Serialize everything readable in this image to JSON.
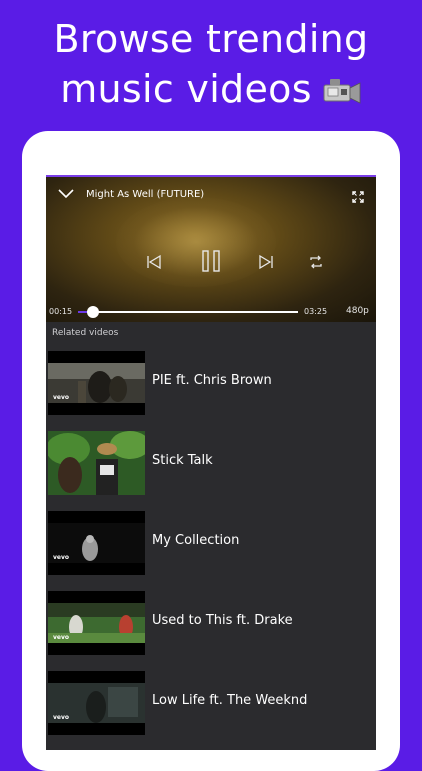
{
  "headline": {
    "line1": "Browse trending",
    "line2": "music videos",
    "emoji": "video-camera-icon"
  },
  "player": {
    "title": "Might As Well (FUTURE)",
    "current_time": "00:15",
    "total_time": "03:25",
    "quality": "480p",
    "progress_fraction": 0.07,
    "icons": [
      "chevron-down-icon",
      "fullscreen-icon",
      "previous-icon",
      "pause-icon",
      "next-icon",
      "repeat-icon"
    ]
  },
  "related": {
    "section_title": "Related videos",
    "items": [
      {
        "title": "PIE ft. Chris Brown",
        "badge": "vevo"
      },
      {
        "title": "Stick Talk",
        "badge": ""
      },
      {
        "title": "My Collection",
        "badge": "vevo"
      },
      {
        "title": "Used to This ft. Drake",
        "badge": "vevo"
      },
      {
        "title": "Low Life ft. The Weeknd",
        "badge": "vevo"
      }
    ]
  },
  "colors": {
    "background": "#5a1ce6",
    "accent": "#6b39e6",
    "list_bg": "#2b2b2e"
  }
}
